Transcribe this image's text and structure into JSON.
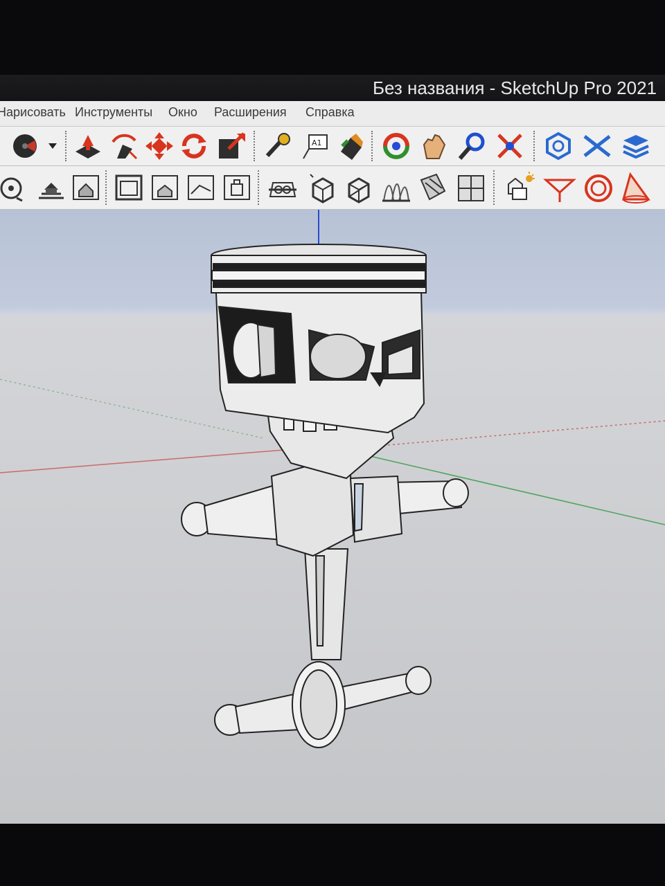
{
  "window": {
    "title": "Без названия - SketchUp Pro 2021"
  },
  "menu": {
    "items": [
      "Нарисовать",
      "Инструменты",
      "Окно",
      "Расширения",
      "Справка"
    ]
  },
  "toolbar_top": {
    "tools": [
      "paint-bucket",
      "eraser-dropdown",
      "push-pull",
      "follow-me",
      "move",
      "rotate",
      "scale",
      "tape-measure",
      "text",
      "paint",
      "orbit",
      "pan",
      "zoom",
      "zoom-extents",
      "components",
      "styles",
      "layers"
    ]
  },
  "toolbar_views": {
    "tools": [
      "orbit-view",
      "iso-view",
      "top-view",
      "front-view",
      "right-view",
      "back-view",
      "left-view",
      "section-plane",
      "display-section",
      "hidden-line",
      "shaded",
      "shaded-texture",
      "monochrome",
      "shadows",
      "fog",
      "soften",
      "perspective"
    ]
  },
  "colors": {
    "axis_red": "#c96a6a",
    "axis_green": "#4aa35a",
    "axis_blue": "#2a4bd6",
    "sky": "#b7c2d6",
    "ground": "#cfd0d3"
  }
}
